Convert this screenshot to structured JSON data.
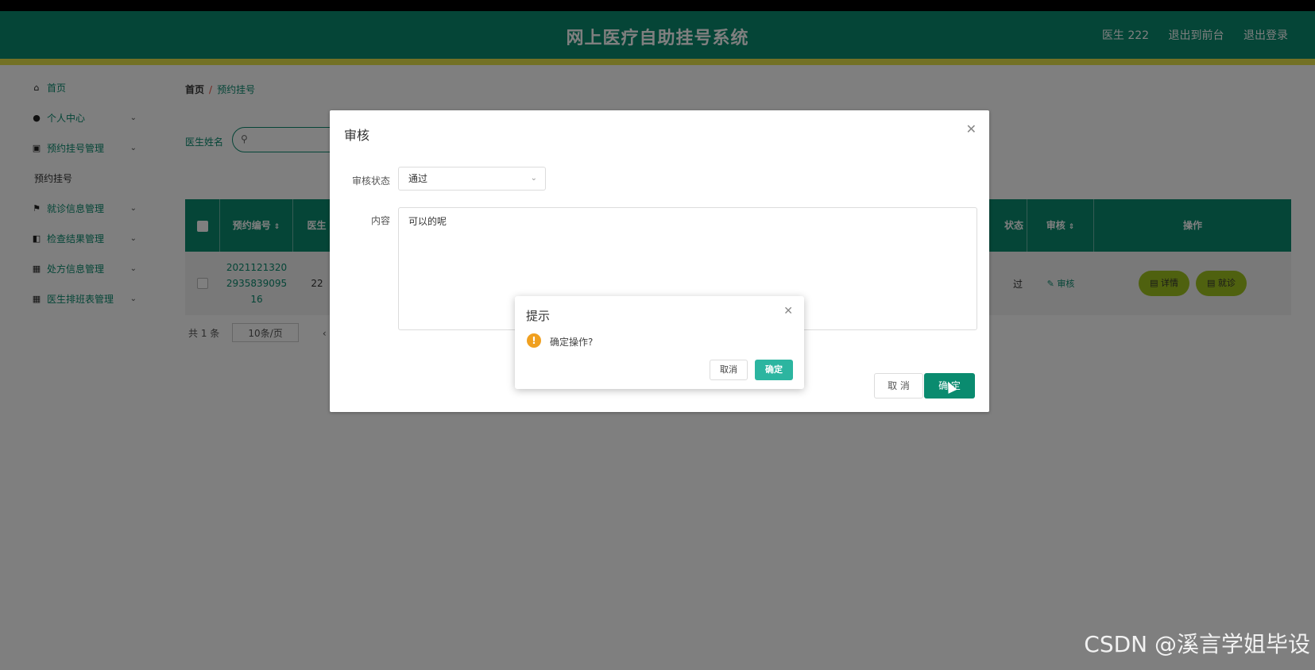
{
  "header": {
    "title": "网上医疗自助挂号系统",
    "user": "医生 222",
    "to_front": "退出到前台",
    "logout": "退出登录"
  },
  "sidebar": {
    "items": [
      {
        "label": "首页",
        "icon": "home-icon"
      },
      {
        "label": "个人中心",
        "icon": "user-icon"
      },
      {
        "label": "预约挂号管理",
        "icon": "chart-icon"
      },
      {
        "label": "预约挂号",
        "icon": ""
      },
      {
        "label": "就诊信息管理",
        "icon": "flag-icon"
      },
      {
        "label": "检查结果管理",
        "icon": "bag-icon"
      },
      {
        "label": "处方信息管理",
        "icon": "grid-icon"
      },
      {
        "label": "医生排班表管理",
        "icon": "grid-icon"
      }
    ]
  },
  "breadcrumb": {
    "home": "首页",
    "current": "预约挂号"
  },
  "search": {
    "label": "医生姓名",
    "placeholder": ""
  },
  "table": {
    "headers": {
      "id": "预约编号",
      "doctor": "医生",
      "status": "状态",
      "audit": "审核",
      "ops": "操作"
    },
    "row": {
      "id": "2021121320293583909516",
      "doctor_fragment": "22",
      "status_fragment": "过",
      "audit_link": "审核",
      "detail_btn": "详情",
      "diagnose_btn": "就诊"
    }
  },
  "pager": {
    "total": "共 1 条",
    "size": "10条/页",
    "prev": "‹"
  },
  "dialog": {
    "title": "审核",
    "status_label": "审核状态",
    "status_value": "通过",
    "content_label": "内容",
    "content_value": "可以的呢",
    "cancel": "取 消",
    "ok": "确 定"
  },
  "msgbox": {
    "title": "提示",
    "message": "确定操作?",
    "cancel": "取消",
    "ok": "确定"
  },
  "watermark": "CSDN @溪言学姐毕设",
  "colors": {
    "primary": "#0a8b6f",
    "accent_bar": "#e6e34a",
    "op_button": "#9fc21f",
    "confirm": "#2cb5a0"
  }
}
